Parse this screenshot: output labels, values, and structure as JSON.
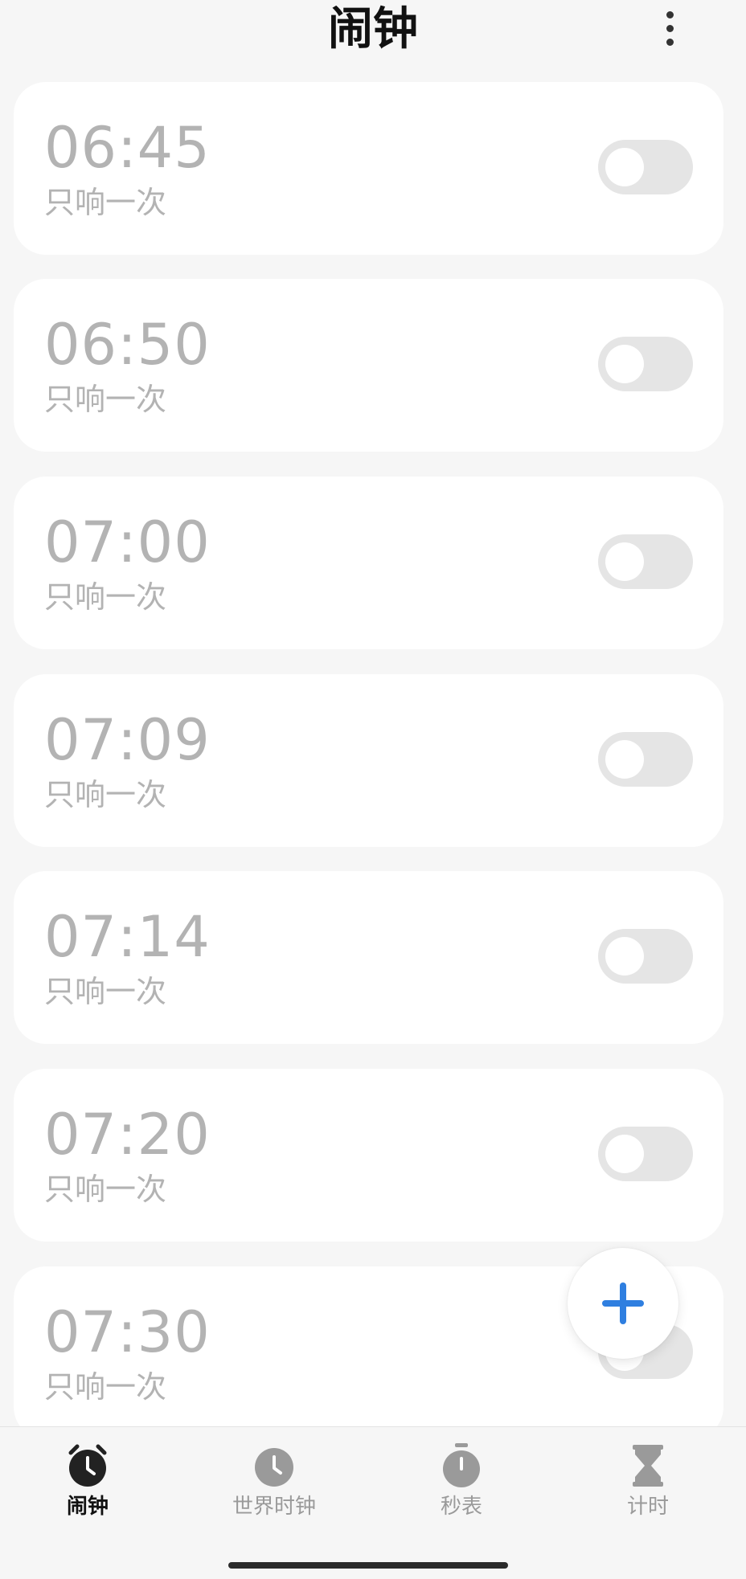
{
  "header": {
    "title": "闹钟",
    "more_icon": "more-vertical-icon"
  },
  "alarms": [
    {
      "time": "06:45",
      "repeat": "只响一次",
      "enabled": false
    },
    {
      "time": "06:50",
      "repeat": "只响一次",
      "enabled": false
    },
    {
      "time": "07:00",
      "repeat": "只响一次",
      "enabled": false
    },
    {
      "time": "07:09",
      "repeat": "只响一次",
      "enabled": false
    },
    {
      "time": "07:14",
      "repeat": "只响一次",
      "enabled": false
    },
    {
      "time": "07:20",
      "repeat": "只响一次",
      "enabled": false
    },
    {
      "time": "07:30",
      "repeat": "只响一次",
      "enabled": false
    }
  ],
  "fab": {
    "icon": "plus-icon",
    "color": "#2f7fe0"
  },
  "bottom_nav": {
    "items": [
      {
        "label": "闹钟",
        "icon": "alarm-clock-icon",
        "active": true
      },
      {
        "label": "世界时钟",
        "icon": "clock-icon",
        "active": false
      },
      {
        "label": "秒表",
        "icon": "stopwatch-icon",
        "active": false
      },
      {
        "label": "计时",
        "icon": "hourglass-icon",
        "active": false
      }
    ]
  },
  "colors": {
    "background": "#f6f6f6",
    "card": "#ffffff",
    "muted_text": "#b3b3b3",
    "toggle_off": "#e5e5e5",
    "nav_active": "#222222",
    "nav_inactive": "#9a9a9a"
  }
}
